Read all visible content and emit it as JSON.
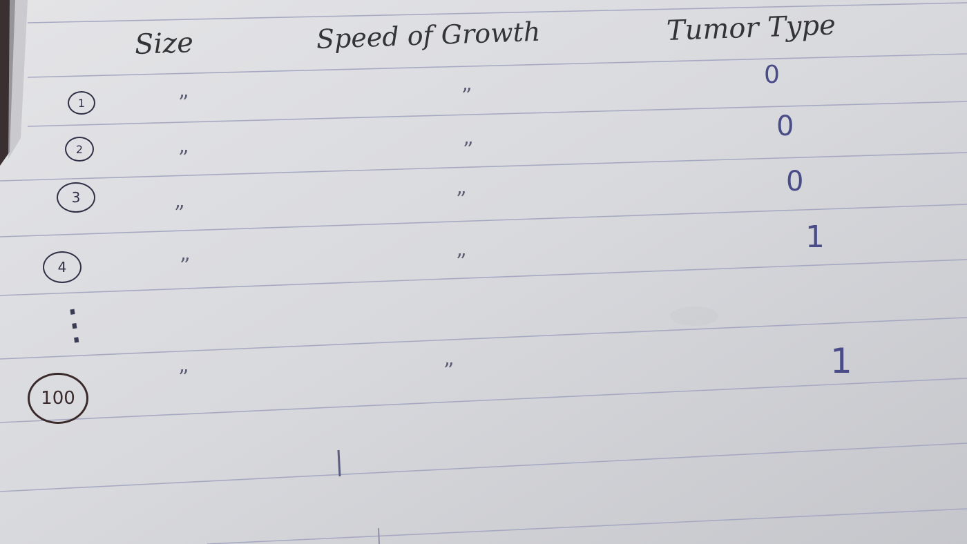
{
  "columns": {
    "size": "Size",
    "speed": "Speed of Growth",
    "type": "Tumor Type"
  },
  "rows": [
    {
      "num": "1",
      "size": "”",
      "speed": "”",
      "type": "0"
    },
    {
      "num": "2",
      "size": "”",
      "speed": "”",
      "type": "0"
    },
    {
      "num": "3",
      "size": "”",
      "speed": "”",
      "type": "0"
    },
    {
      "num": "4",
      "size": "”",
      "speed": "”",
      "type": "1"
    },
    {
      "num": "100",
      "size": "”",
      "speed": "”",
      "type": "1"
    }
  ],
  "ellipsis": "⋮"
}
